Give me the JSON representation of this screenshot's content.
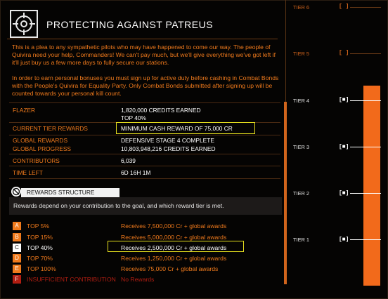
{
  "header": {
    "title": "PROTECTING AGAINST PATREUS",
    "icon": "crosshair-icon"
  },
  "intro": {
    "p1": "This is a plea to any sympathetic pilots who may have happened to come our way. The people of Quivira need your help, Commanders! We can't pay much, but we'll give everything we've got left if it'll just buy us a few more days to fully secure our stations.",
    "p2": "In order to earn personal bonuses you must sign up for active duty before cashing in Combat Bonds with the People's Quivira for Equality Party. Only Combat Bonds submitted after signing up will be counted towards your personal kill count."
  },
  "details": {
    "commander": {
      "label": "FLAZER",
      "value": "1,820,000 CREDITS EARNED",
      "value2": "TOP 40%"
    },
    "current_tier": {
      "label": "CURRENT TIER REWARDS",
      "value": "MINIMUM CASH REWARD OF 75,000 CR"
    },
    "global_rewards": {
      "label": "GLOBAL REWARDS",
      "value": "DEFENSIVE STAGE 4 COMPLETE"
    },
    "global_progress": {
      "label": "GLOBAL PROGRESS",
      "value": "10,803,948,216 CREDITS EARNED"
    },
    "contributors": {
      "label": "CONTRIBUTORS",
      "value": "6,039"
    },
    "time_left": {
      "label": "TIME LEFT",
      "value": "6D 16H 1M"
    }
  },
  "rewards_structure": {
    "title": "REWARDS STRUCTURE",
    "description": "Rewards depend on your contribution to the goal, and which reward tier is met.",
    "tiers": [
      {
        "badge": "A",
        "name": "TOP 5%",
        "reward": "Receives 7,500,000 Cr + global awards",
        "color": "#f07a1c"
      },
      {
        "badge": "B",
        "name": "TOP 15%",
        "reward": "Receives 5,000,000 Cr + global awards",
        "color": "#f07a1c"
      },
      {
        "badge": "C",
        "name": "TOP 40%",
        "reward": "Receives 2,500,000 Cr + global awards",
        "color": "#ffffff"
      },
      {
        "badge": "D",
        "name": "TOP 70%",
        "reward": "Receives 1,250,000 Cr + global awards",
        "color": "#f07a1c"
      },
      {
        "badge": "E",
        "name": "TOP 100%",
        "reward": "Receives 75,000 Cr + global awards",
        "color": "#f07a1c"
      },
      {
        "badge": "F",
        "name": "INSUFFICIENT CONTRIBUTION",
        "reward": "No Rewards",
        "color": "#b21e12"
      }
    ]
  },
  "tier_panel": {
    "tiers": [
      {
        "label": "TIER 6",
        "marker": "[ ]",
        "achieved": false
      },
      {
        "label": "TIER 5",
        "marker": "[ ]",
        "achieved": false
      },
      {
        "label": "TIER 4",
        "marker": "[■]",
        "achieved": true
      },
      {
        "label": "TIER 3",
        "marker": "[■]",
        "achieved": true
      },
      {
        "label": "TIER 2",
        "marker": "[■]",
        "achieved": true
      },
      {
        "label": "TIER 1",
        "marker": "[■]",
        "achieved": true
      }
    ]
  },
  "colors": {
    "accent": "#f07a1c",
    "highlight": "#e6df1e",
    "text": "#ffffff"
  }
}
